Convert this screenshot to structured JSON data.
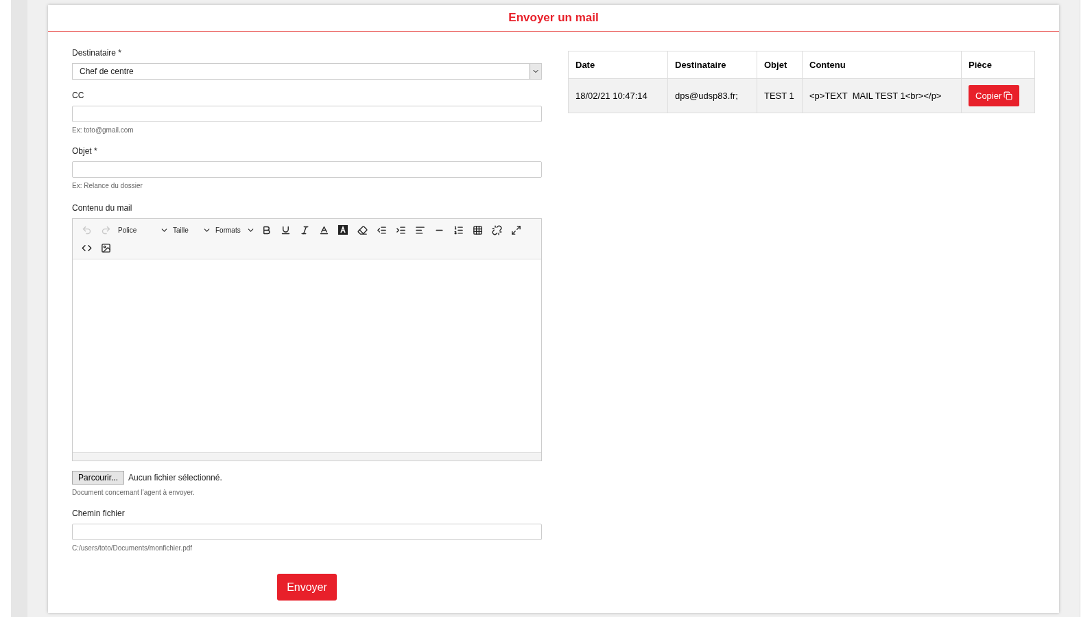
{
  "title": "Envoyer un mail",
  "form": {
    "recipient": {
      "label": "Destinataire *",
      "value": "Chef de centre"
    },
    "cc": {
      "label": "CC",
      "help": "Ex: toto@gmail.com"
    },
    "subject": {
      "label": "Objet *",
      "help": "Ex: Relance du dossier"
    },
    "content": {
      "label": "Contenu du mail",
      "toolbar": {
        "undo": {
          "disabled": true
        },
        "redo": {
          "disabled": true
        },
        "dropdowns": [
          "Police",
          "Taille",
          "Formats"
        ]
      }
    },
    "file": {
      "button": "Parcourir...",
      "status": "Aucun fichier sélectionné.",
      "help": "Document concernant l'agent à envoyer."
    },
    "path": {
      "label": "Chemin fichier",
      "help": "C:/users/toto/Documents/monfichier.pdf"
    },
    "submit": "Envoyer"
  },
  "table": {
    "columns": [
      "Date",
      "Destinataire",
      "Objet",
      "Contenu",
      "Pièce"
    ],
    "rows": [
      {
        "date": "18/02/21 10:47:14",
        "recipient": "dps@udsp83.fr;",
        "subject": "TEST 1",
        "content": "<p>TEXT  MAIL TEST 1<br></p>",
        "action": "Copier"
      }
    ]
  }
}
